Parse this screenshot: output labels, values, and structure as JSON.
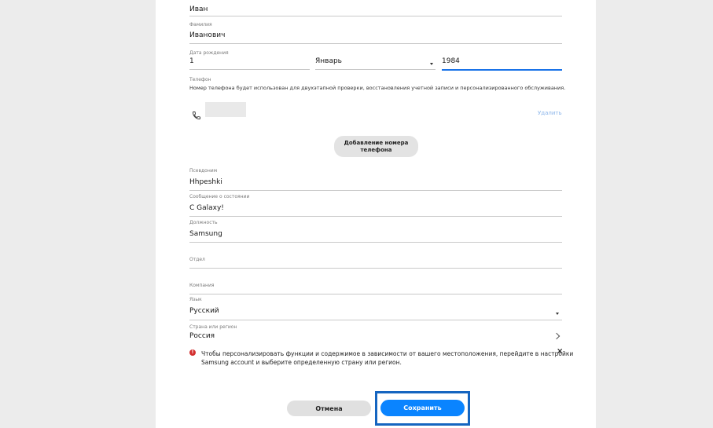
{
  "form": {
    "first_name": {
      "value": "Иван"
    },
    "last_name": {
      "label": "Фамилия",
      "value": "Иванович"
    },
    "birth_date": {
      "label": "Дата рождения",
      "day": "1",
      "month": "Январь",
      "year": "1984"
    },
    "phone": {
      "label": "Телефон",
      "description": "Номер телефона будет использован для двухэтапной проверки, восстановления учетной записи и персонализированного обслуживания.",
      "delete_label": "Удалить",
      "add_button_line1": "Добавление номера",
      "add_button_line2": "телефона"
    },
    "nickname": {
      "label": "Псевдоним",
      "value": "Hhpeshki"
    },
    "status_message": {
      "label": "Сообщение о состоянии",
      "value": "С Galaxy!"
    },
    "position": {
      "label": "Должность",
      "value": "Samsung"
    },
    "department": {
      "label": "Отдел",
      "value": ""
    },
    "company": {
      "label": "Компания",
      "value": ""
    },
    "language": {
      "label": "Язык",
      "value": "Русский"
    },
    "country": {
      "label": "Страна или регион",
      "value": "Россия"
    },
    "notice": {
      "line1": "Чтобы персонализировать функции и содержимое в зависимости от вашего местоположения, перейдите в настройки",
      "line2": "Samsung account и выберите определенную страну или регион."
    }
  },
  "actions": {
    "cancel_label": "Отмена",
    "save_label": "Сохранить"
  },
  "colors": {
    "accent": "#1a73e8",
    "save_button": "#0a84ff",
    "highlight_box": "#1565c0",
    "error": "#d32f2f"
  }
}
